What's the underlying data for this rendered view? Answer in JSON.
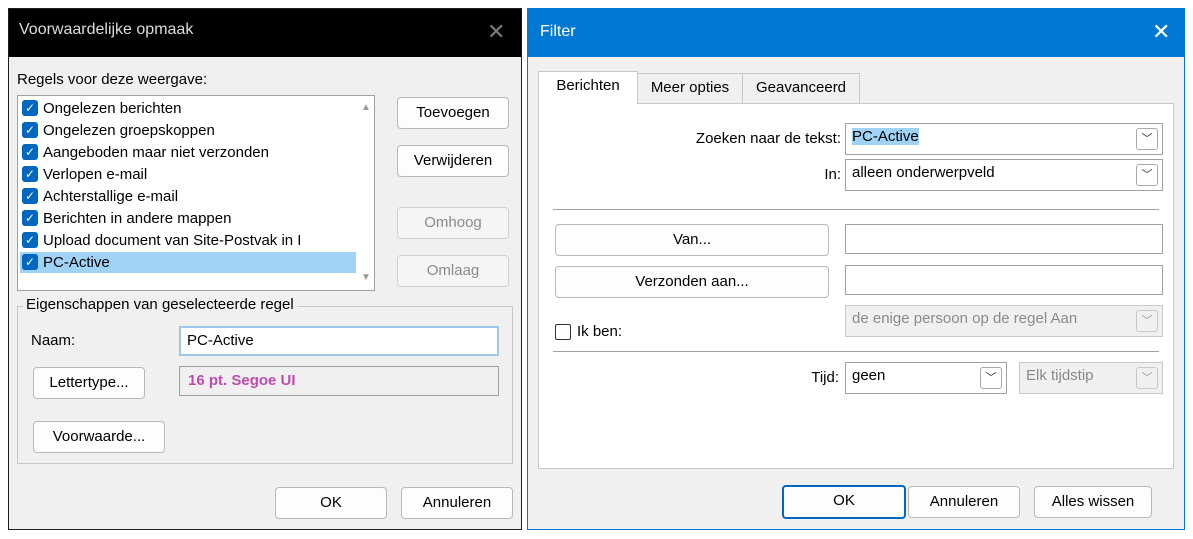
{
  "left_dialog": {
    "title": "Voorwaardelijke opmaak",
    "rules_label": "Regels voor deze weergave:",
    "rules": [
      {
        "label": "Ongelezen berichten",
        "checked": true
      },
      {
        "label": "Ongelezen groepskoppen",
        "checked": true
      },
      {
        "label": "Aangeboden maar niet verzonden",
        "checked": true
      },
      {
        "label": "Verlopen e-mail",
        "checked": true
      },
      {
        "label": "Achterstallige e-mail",
        "checked": true
      },
      {
        "label": "Berichten in andere mappen",
        "checked": true
      },
      {
        "label": "Upload document van Site-Postvak in I",
        "checked": true
      },
      {
        "label": "PC-Active",
        "checked": true,
        "selected": true
      }
    ],
    "buttons": {
      "add": "Toevoegen",
      "remove": "Verwijderen",
      "up": "Omhoog",
      "down": "Omlaag",
      "ok": "OK",
      "cancel": "Annuleren"
    },
    "properties": {
      "group_label": "Eigenschappen van geselecteerde regel",
      "name_label": "Naam:",
      "name_value": "PC-Active",
      "font_button": "Lettertype...",
      "font_preview": "16 pt. Segoe UI",
      "font_preview_color": "#c04bb0",
      "condition_button": "Voorwaarde..."
    }
  },
  "right_dialog": {
    "title": "Filter",
    "accent_color": "#0078d4",
    "tabs": [
      "Berichten",
      "Meer opties",
      "Geavanceerd"
    ],
    "active_tab": "Berichten",
    "search_label": "Zoeken naar de tekst:",
    "search_value": "PC-Active",
    "in_label": "In:",
    "in_value": "alleen onderwerpveld",
    "from_button": "Van...",
    "from_value": "",
    "sent_to_button": "Verzonden aan...",
    "sent_to_value": "",
    "i_am_label": "Ik ben:",
    "i_am_checked": false,
    "i_am_value": "de enige persoon op de regel Aan",
    "time_label": "Tijd:",
    "time_value": "geen",
    "time_range_value": "Elk tijdstip",
    "buttons": {
      "ok": "OK",
      "cancel": "Annuleren",
      "clear_all": "Alles wissen"
    }
  },
  "icons": {
    "close": "close-icon",
    "checkbox": "check-icon",
    "dropdown": "chevron-down-icon"
  }
}
